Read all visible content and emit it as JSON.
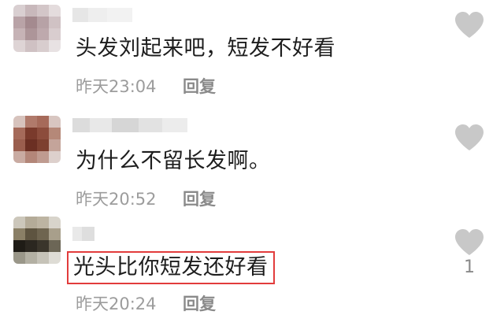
{
  "comments": [
    {
      "text": "头发刘起来吧，短发不好看",
      "time": "昨天23:04",
      "reply_label": "回复",
      "like_count": ""
    },
    {
      "text": "为什么不留长发啊。",
      "time": "昨天20:52",
      "reply_label": "回复",
      "like_count": ""
    },
    {
      "text": "光头比你短发还好看",
      "time": "昨天20:24",
      "reply_label": "回复",
      "like_count": "1"
    }
  ],
  "colors": {
    "highlight_border": "#e23c3c",
    "heart_icon": "#c8c8c8",
    "meta_text": "#9c9c9c",
    "body_text": "#1d1d1d"
  },
  "icons": {
    "like": "heart-icon"
  }
}
